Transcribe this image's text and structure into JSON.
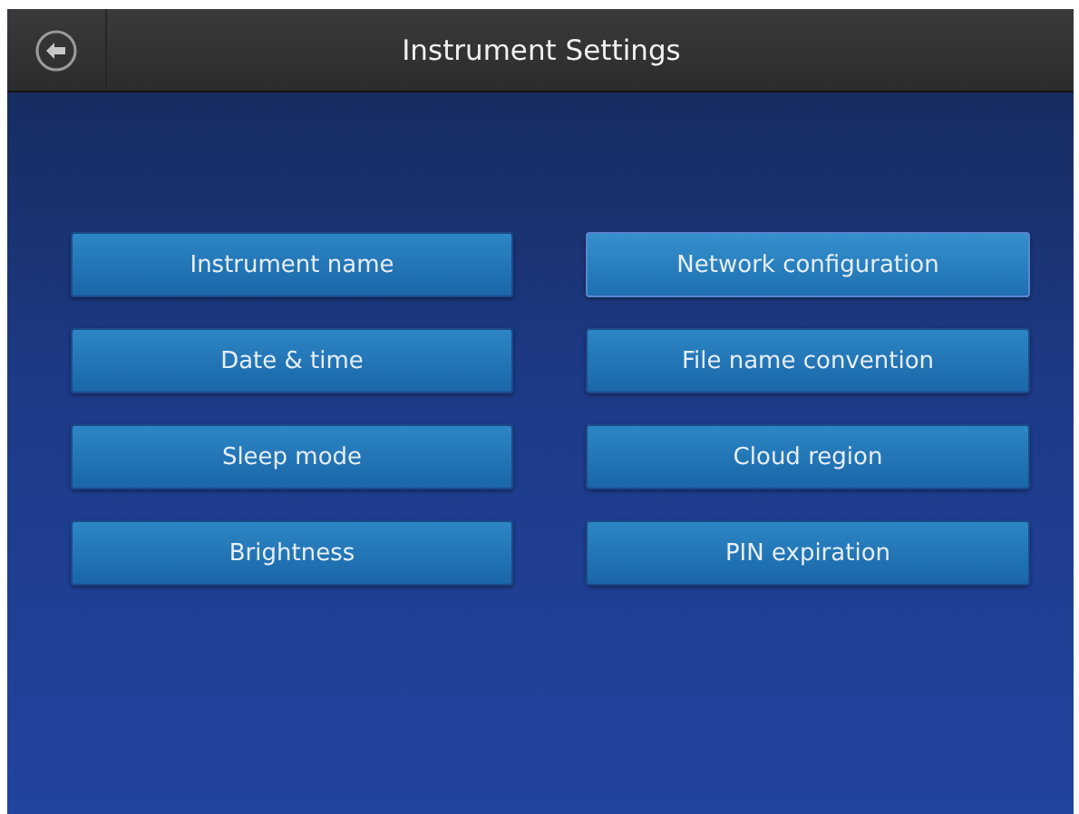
{
  "window": {
    "title": "Instrument Settings"
  },
  "buttons": [
    {
      "label": "Instrument name",
      "selected": false
    },
    {
      "label": "Network configuration",
      "selected": true
    },
    {
      "label": "Date & time",
      "selected": false
    },
    {
      "label": "File name convention",
      "selected": false
    },
    {
      "label": "Sleep mode",
      "selected": false
    },
    {
      "label": "Cloud region",
      "selected": false
    },
    {
      "label": "Brightness",
      "selected": false
    },
    {
      "label": "PIN expiration",
      "selected": false
    }
  ]
}
